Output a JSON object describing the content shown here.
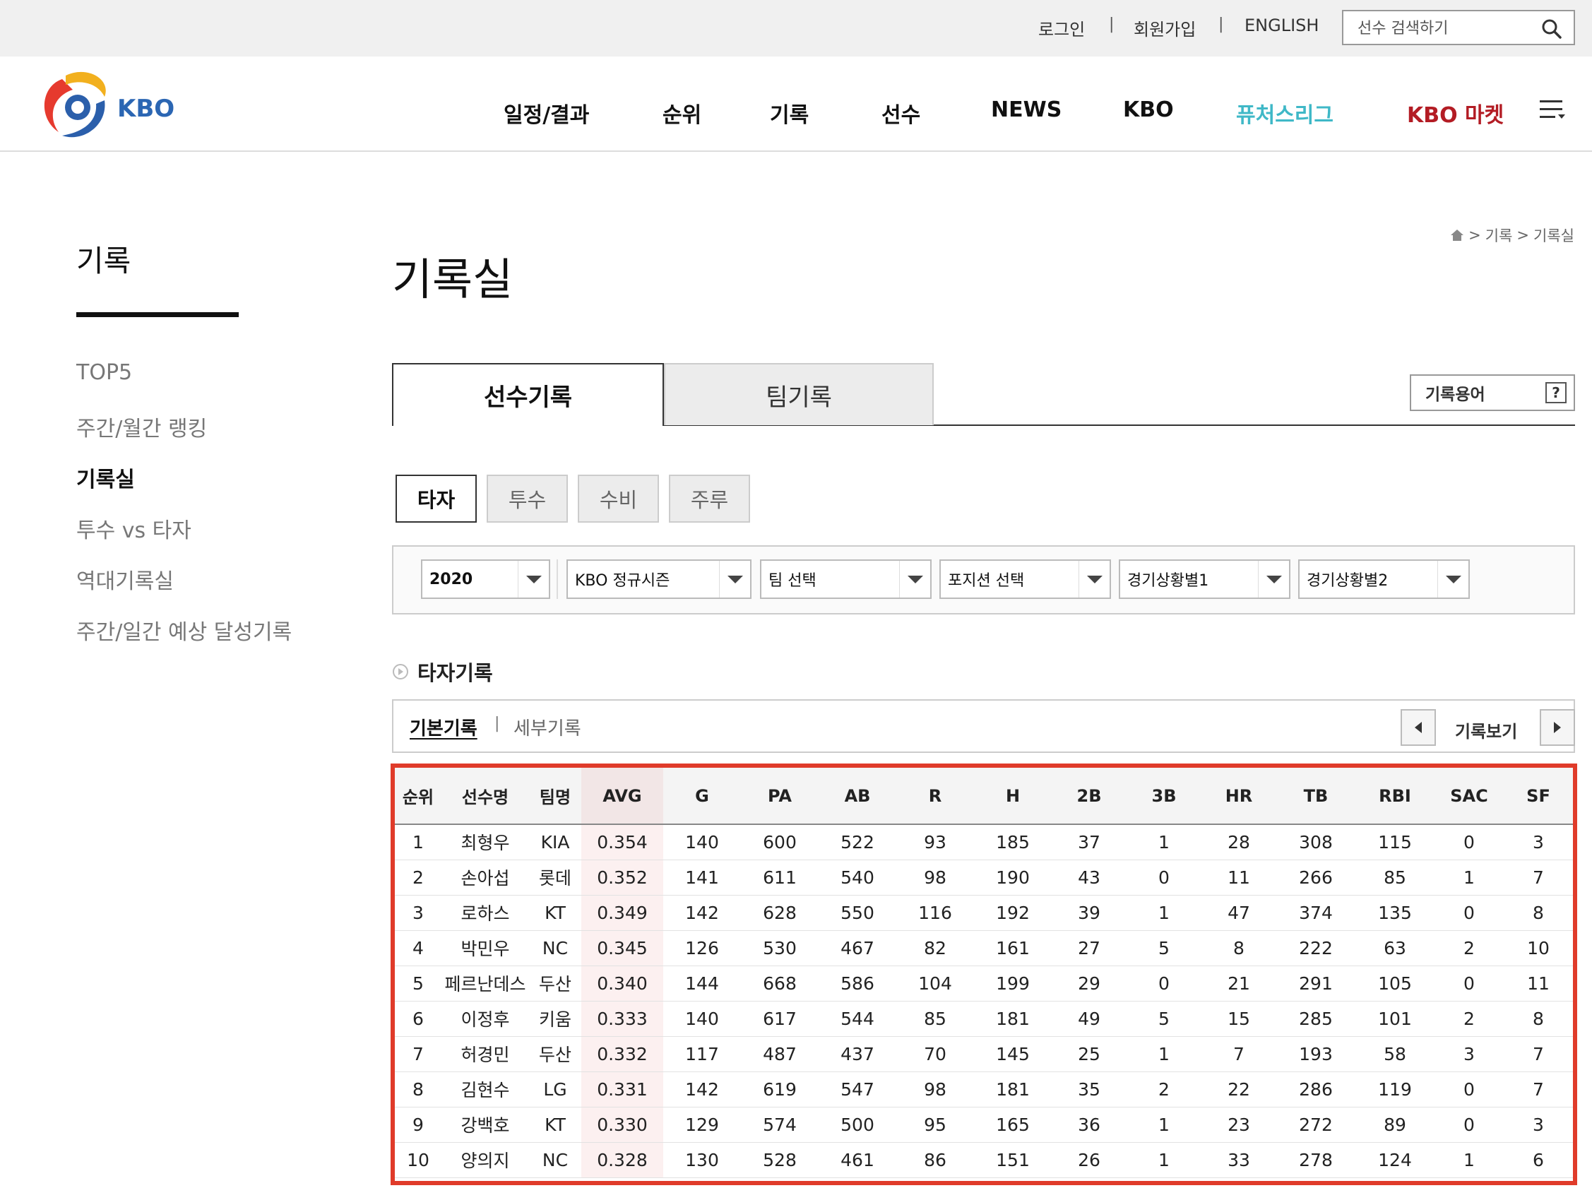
{
  "utility": {
    "login": "로그인",
    "signup": "회원가입",
    "english": "ENGLISH",
    "search_placeholder": "선수 검색하기"
  },
  "header": {
    "logo_text": "KBO",
    "nav": [
      "일정/결과",
      "순위",
      "기록",
      "선수",
      "NEWS",
      "KBO",
      "퓨처스리그",
      "KBO 마켓"
    ]
  },
  "sidebar": {
    "title": "기록",
    "items": [
      {
        "label": "TOP5",
        "active": false
      },
      {
        "label": "주간/월간 랭킹",
        "active": false
      },
      {
        "label": "기록실",
        "active": true
      },
      {
        "label": "투수 vs 타자",
        "active": false
      },
      {
        "label": "역대기록실",
        "active": false
      },
      {
        "label": "주간/일간 예상 달성기록",
        "active": false
      }
    ]
  },
  "breadcrumb": {
    "items": [
      "기록",
      "기록실"
    ]
  },
  "main": {
    "title": "기록실",
    "tabs": [
      "선수기록",
      "팀기록"
    ],
    "term_button": "기록용어",
    "term_icon_text": "?",
    "sub_tabs": [
      "타자",
      "투수",
      "수비",
      "주루"
    ],
    "filters": [
      "2020",
      "KBO 정규시즌",
      "팀 선택",
      "포지션 선택",
      "경기상황별1",
      "경기상황별2"
    ],
    "section_title": "타자기록",
    "record_basic": "기본기록",
    "record_detail": "세부기록",
    "record_view": "기록보기"
  },
  "colors": {
    "futures": "#3fb8c7",
    "market": "#b31c24",
    "highlight_border": "#e03b2a",
    "avg_column": "#fcf0f0"
  },
  "table": {
    "headers": [
      "순위",
      "선수명",
      "팀명",
      "AVG",
      "G",
      "PA",
      "AB",
      "R",
      "H",
      "2B",
      "3B",
      "HR",
      "TB",
      "RBI",
      "SAC",
      "SF"
    ],
    "rows": [
      [
        "1",
        "최형우",
        "KIA",
        "0.354",
        "140",
        "600",
        "522",
        "93",
        "185",
        "37",
        "1",
        "28",
        "308",
        "115",
        "0",
        "3"
      ],
      [
        "2",
        "손아섭",
        "롯데",
        "0.352",
        "141",
        "611",
        "540",
        "98",
        "190",
        "43",
        "0",
        "11",
        "266",
        "85",
        "1",
        "7"
      ],
      [
        "3",
        "로하스",
        "KT",
        "0.349",
        "142",
        "628",
        "550",
        "116",
        "192",
        "39",
        "1",
        "47",
        "374",
        "135",
        "0",
        "8"
      ],
      [
        "4",
        "박민우",
        "NC",
        "0.345",
        "126",
        "530",
        "467",
        "82",
        "161",
        "27",
        "5",
        "8",
        "222",
        "63",
        "2",
        "10"
      ],
      [
        "5",
        "페르난데스",
        "두산",
        "0.340",
        "144",
        "668",
        "586",
        "104",
        "199",
        "29",
        "0",
        "21",
        "291",
        "105",
        "0",
        "11"
      ],
      [
        "6",
        "이정후",
        "키움",
        "0.333",
        "140",
        "617",
        "544",
        "85",
        "181",
        "49",
        "5",
        "15",
        "285",
        "101",
        "2",
        "8"
      ],
      [
        "7",
        "허경민",
        "두산",
        "0.332",
        "117",
        "487",
        "437",
        "70",
        "145",
        "25",
        "1",
        "7",
        "193",
        "58",
        "3",
        "7"
      ],
      [
        "8",
        "김현수",
        "LG",
        "0.331",
        "142",
        "619",
        "547",
        "98",
        "181",
        "35",
        "2",
        "22",
        "286",
        "119",
        "0",
        "7"
      ],
      [
        "9",
        "강백호",
        "KT",
        "0.330",
        "129",
        "574",
        "500",
        "95",
        "165",
        "36",
        "1",
        "23",
        "272",
        "89",
        "0",
        "3"
      ],
      [
        "10",
        "양의지",
        "NC",
        "0.328",
        "130",
        "528",
        "461",
        "86",
        "151",
        "26",
        "1",
        "33",
        "278",
        "124",
        "1",
        "6"
      ]
    ]
  }
}
